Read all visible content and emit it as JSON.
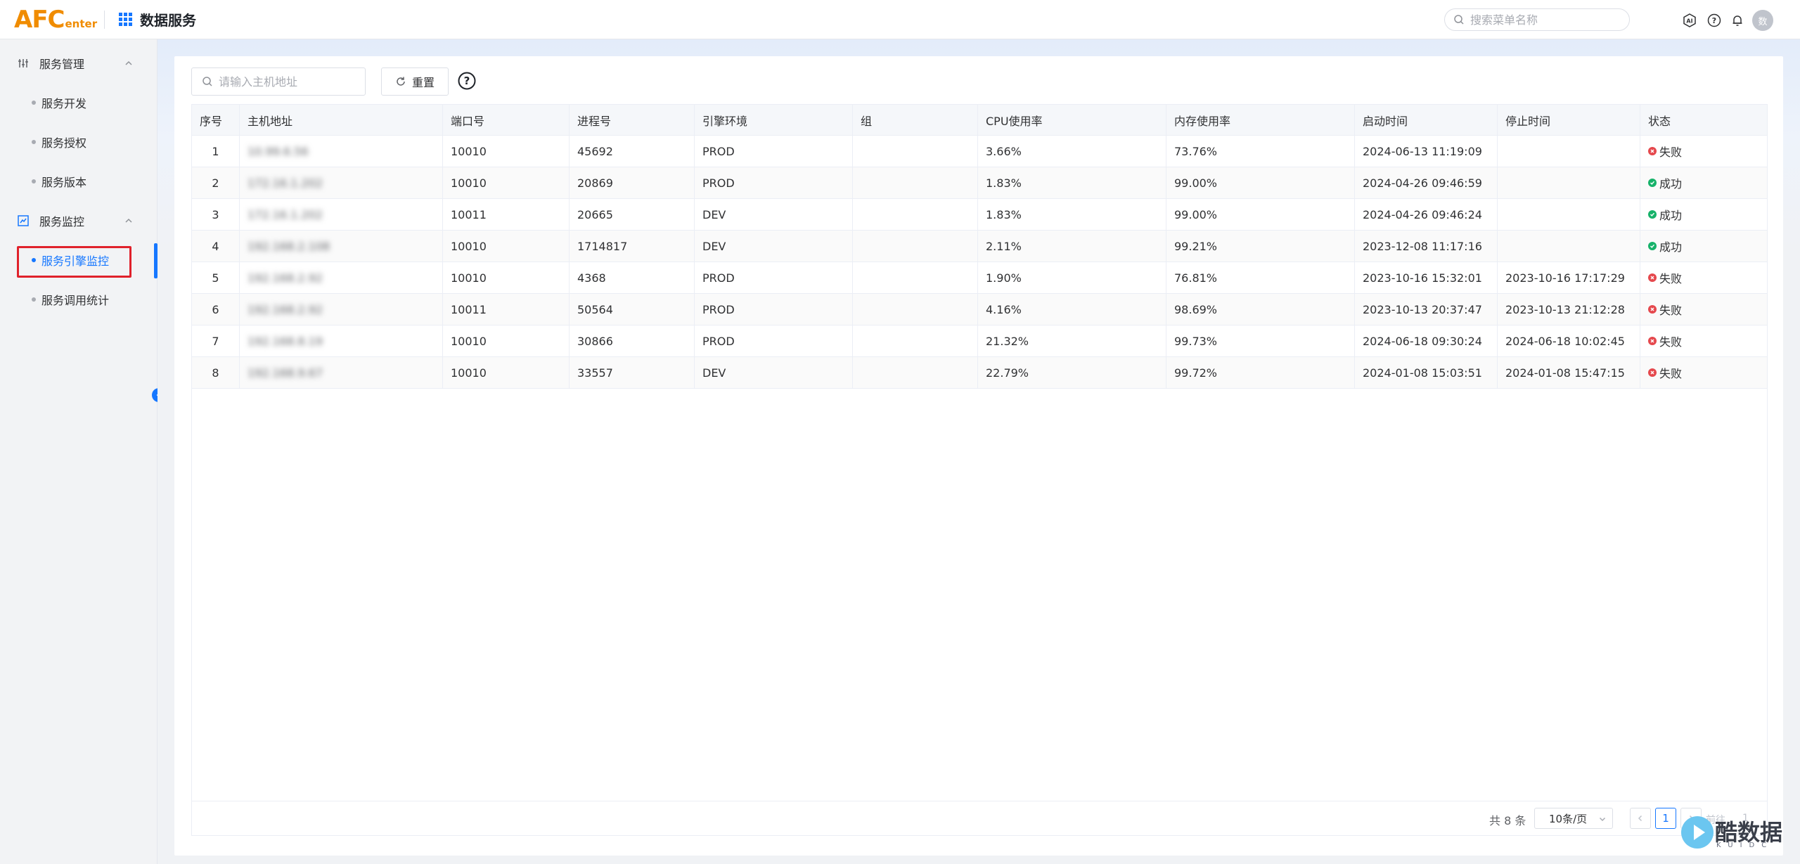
{
  "header": {
    "logo_big": "AFC",
    "logo_small": "enter",
    "app_title": "数据服务",
    "search_placeholder": "搜索菜单名称",
    "avatar_text": "数"
  },
  "sidebar": {
    "groups": [
      {
        "label": "服务管理"
      },
      {
        "label": "服务监控"
      }
    ],
    "items": [
      {
        "label": "服务开发"
      },
      {
        "label": "服务授权"
      },
      {
        "label": "服务版本"
      },
      {
        "label": "服务引擎监控",
        "active": true
      },
      {
        "label": "服务调用统计"
      }
    ]
  },
  "filters": {
    "host_placeholder": "请输入主机地址",
    "reset_label": "重置"
  },
  "table": {
    "columns": [
      "序号",
      "主机地址",
      "端口号",
      "进程号",
      "引擎环境",
      "组",
      "CPU使用率",
      "内存使用率",
      "启动时间",
      "停止时间",
      "状态"
    ],
    "rows": [
      {
        "idx": "1",
        "host": "10.99.6.56",
        "port": "10010",
        "pid": "45692",
        "env": "PROD",
        "group": "",
        "cpu": "3.66%",
        "mem": "73.76%",
        "start": "2024-06-13 11:19:09",
        "stop": "",
        "status": "失败",
        "status_type": "fail"
      },
      {
        "idx": "2",
        "host": "172.16.1.202",
        "port": "10010",
        "pid": "20869",
        "env": "PROD",
        "group": "",
        "cpu": "1.83%",
        "mem": "99.00%",
        "start": "2024-04-26 09:46:59",
        "stop": "",
        "status": "成功",
        "status_type": "ok"
      },
      {
        "idx": "3",
        "host": "172.16.1.202",
        "port": "10011",
        "pid": "20665",
        "env": "DEV",
        "group": "",
        "cpu": "1.83%",
        "mem": "99.00%",
        "start": "2024-04-26 09:46:24",
        "stop": "",
        "status": "成功",
        "status_type": "ok"
      },
      {
        "idx": "4",
        "host": "192.168.2.108",
        "port": "10010",
        "pid": "1714817",
        "env": "DEV",
        "group": "",
        "cpu": "2.11%",
        "mem": "99.21%",
        "start": "2023-12-08 11:17:16",
        "stop": "",
        "status": "成功",
        "status_type": "ok"
      },
      {
        "idx": "5",
        "host": "192.168.2.92",
        "port": "10010",
        "pid": "4368",
        "env": "PROD",
        "group": "",
        "cpu": "1.90%",
        "mem": "76.81%",
        "start": "2023-10-16 15:32:01",
        "stop": "2023-10-16 17:17:29",
        "status": "失败",
        "status_type": "fail"
      },
      {
        "idx": "6",
        "host": "192.168.2.92",
        "port": "10011",
        "pid": "50564",
        "env": "PROD",
        "group": "",
        "cpu": "4.16%",
        "mem": "98.69%",
        "start": "2023-10-13 20:37:47",
        "stop": "2023-10-13 21:12:28",
        "status": "失败",
        "status_type": "fail"
      },
      {
        "idx": "7",
        "host": "192.168.8.19",
        "port": "10010",
        "pid": "30866",
        "env": "PROD",
        "group": "",
        "cpu": "21.32%",
        "mem": "99.73%",
        "start": "2024-06-18 09:30:24",
        "stop": "2024-06-18 10:02:45",
        "status": "失败",
        "status_type": "fail"
      },
      {
        "idx": "8",
        "host": "192.168.9.67",
        "port": "10010",
        "pid": "33557",
        "env": "DEV",
        "group": "",
        "cpu": "22.79%",
        "mem": "99.72%",
        "start": "2024-01-08 15:03:51",
        "stop": "2024-01-08 15:47:15",
        "status": "失败",
        "status_type": "fail"
      }
    ]
  },
  "pagination": {
    "total": "共 8 条",
    "page_size": "10条/页",
    "current_page": "1",
    "jump_label": "前往",
    "jump_value": "1"
  },
  "watermark": {
    "text": "酷数据",
    "sub": "KUIDC"
  },
  "colors": {
    "accent": "#1677ff",
    "logo": "#f08c00",
    "fail": "#e5484d",
    "success": "#17b26a",
    "highlight_box": "#e0212b"
  }
}
